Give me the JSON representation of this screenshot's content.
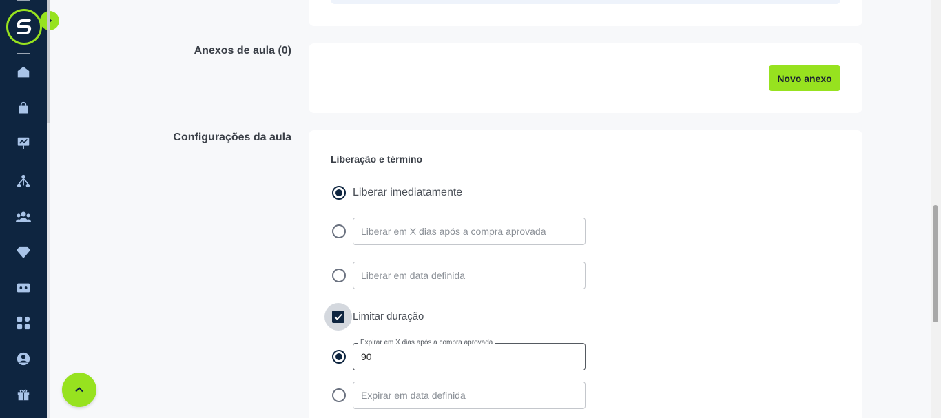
{
  "sidebar": {
    "icons": [
      "home-icon",
      "shopping-bag-icon",
      "presentation-chart-icon",
      "network-icon",
      "users-icon",
      "diamond-icon",
      "ticket-icon",
      "apps-icon",
      "account-icon",
      "gift-icon"
    ]
  },
  "sections": {
    "anexos": {
      "title": "Anexos de aula (0)",
      "button_label": "Novo anexo"
    },
    "config": {
      "title": "Configurações da aula",
      "subheading": "Liberação e término",
      "release_immediately_label": "Liberar imediatamente",
      "release_days_placeholder": "Liberar em X dias após a compra aprovada",
      "release_date_placeholder": "Liberar em data definida",
      "limit_duration_label": "Limitar duração",
      "expire_days_label": "Expirar em X dias após a compra aprovada",
      "expire_days_value": "90",
      "expire_date_placeholder": "Expirar em data definida"
    }
  },
  "colors": {
    "sidebar_bg": "#0e2540",
    "accent": "#97e21f",
    "page_bg": "#f7f8fa"
  }
}
